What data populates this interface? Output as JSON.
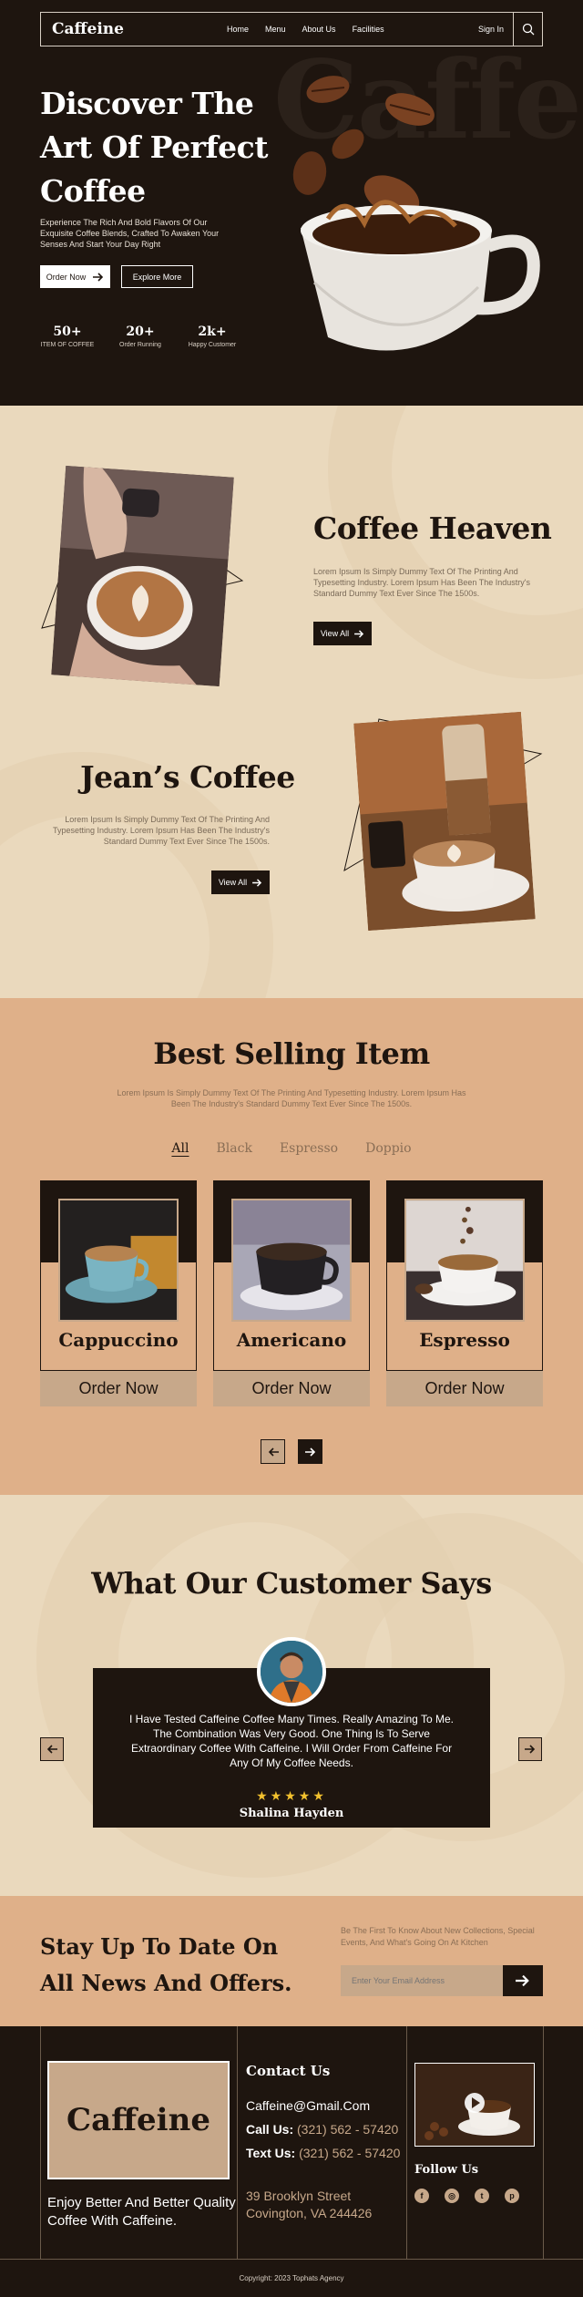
{
  "nav": {
    "logo": "Caffeine",
    "links": [
      "Home",
      "Menu",
      "About Us",
      "Facilities"
    ],
    "signin": "Sign In",
    "search_icon": "search-icon"
  },
  "hero": {
    "bg_word": "Caffeine",
    "title": "Discover The Art Of Perfect Coffee",
    "description": "Experience The Rich And Bold Flavors Of Our Exquisite Coffee Blends, Crafted To Awaken Your Senses And Start Your Day Right",
    "order_now": "Order Now",
    "explore_more": "Explore More",
    "stats": [
      {
        "value": "50+",
        "label": "ITEM OF COFFEE"
      },
      {
        "value": "20+",
        "label": "Order Running"
      },
      {
        "value": "2k+",
        "label": "Happy Customer"
      }
    ]
  },
  "about": {
    "items": [
      {
        "title": "Coffee Heaven",
        "text": "Lorem Ipsum Is Simply Dummy Text Of The Printing And Typesetting Industry. Lorem Ipsum Has Been The Industry's Standard Dummy Text Ever Since The 1500s.",
        "button": "View All"
      },
      {
        "title": "Jean’s Coffee",
        "text": "Lorem Ipsum Is Simply Dummy Text Of The Printing And Typesetting Industry. Lorem Ipsum Has Been The Industry's Standard Dummy Text Ever Since The 1500s.",
        "button": "View All"
      }
    ]
  },
  "best": {
    "title": "Best Selling Item",
    "subtitle": "Lorem Ipsum Is Simply Dummy Text Of The Printing And Typesetting Industry. Lorem Ipsum Has Been The Industry's Standard Dummy Text Ever Since The 1500s.",
    "tabs": [
      "All",
      "Black",
      "Espresso",
      "Doppio"
    ],
    "active_tab": "All",
    "items": [
      {
        "name": "Cappuccino",
        "button": "Order Now"
      },
      {
        "name": "Americano",
        "button": "Order Now"
      },
      {
        "name": "Espresso",
        "button": "Order Now"
      }
    ]
  },
  "testimonial": {
    "title": "What Our Customer Says",
    "quote": "I Have Tested Caffeine Coffee Many Times. Really Amazing To Me. The Combination Was Very Good. One Thing Is To Serve Extraordinary Coffee With Caffeine. I Will Order From Caffeine For Any Of My Coffee Needs.",
    "stars": "★★★★★",
    "rating": 5,
    "name": "Shalina Hayden"
  },
  "newsletter": {
    "title": "Stay Up To Date On All News And Offers.",
    "text": "Be The First To Know About New Collections, Special Events, And What's Going On At Kitchen",
    "placeholder": "Enter Your Email Address"
  },
  "footer": {
    "logo": "Caffeine",
    "tagline": "Enjoy Better And Better Quality Coffee With Caffeine.",
    "contact_title": "Contact Us",
    "email": "Caffeine@Gmail.Com",
    "call_label": "Call Us:",
    "call_value": "(321) 562 - 57420",
    "text_label": "Text Us:",
    "text_value": "(321) 562 - 57420",
    "address_line1": "39 Brooklyn Street",
    "address_line2": "Covington, VA 244426",
    "follow_title": "Follow Us",
    "copyright": "Copyright: 2023 Tophats Agency"
  },
  "colors": {
    "dark": "#1e150f",
    "cream": "#ead9bd",
    "tan": "#dfb089",
    "beige": "#c7a88a",
    "star": "#f2c12e"
  }
}
